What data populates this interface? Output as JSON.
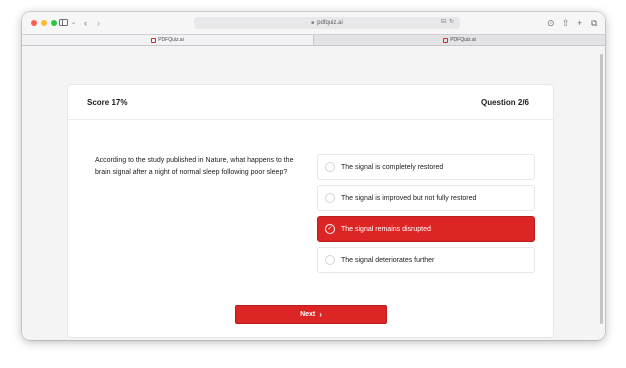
{
  "browser": {
    "url": "pdfquiz.ai",
    "tabs": [
      {
        "label": "PDFQuiz.ai",
        "active": true
      },
      {
        "label": "PDFQuiz.ai",
        "active": false
      }
    ],
    "icons": {
      "back": "chevron-left-icon",
      "forward": "chevron-right-icon",
      "download": "download-icon",
      "share": "share-icon",
      "new_tab": "plus-icon",
      "tabs_overview": "tabs-icon"
    }
  },
  "quiz": {
    "score": "Score 17%",
    "question_counter": "Question 2/6",
    "question": "According to the study published in Nature, what happens to the brain signal after a night of normal sleep following poor sleep?",
    "options": [
      {
        "label": "The signal is completely restored",
        "selected": false
      },
      {
        "label": "The signal is improved but not fully restored",
        "selected": false
      },
      {
        "label": "The signal remains disrupted",
        "selected": true
      },
      {
        "label": "The signal deteriorates further",
        "selected": false
      }
    ],
    "next_label": "Next"
  },
  "colors": {
    "accent": "#dc2626",
    "accent_border": "#b91c1c",
    "page_background": "#f4f4f5"
  }
}
